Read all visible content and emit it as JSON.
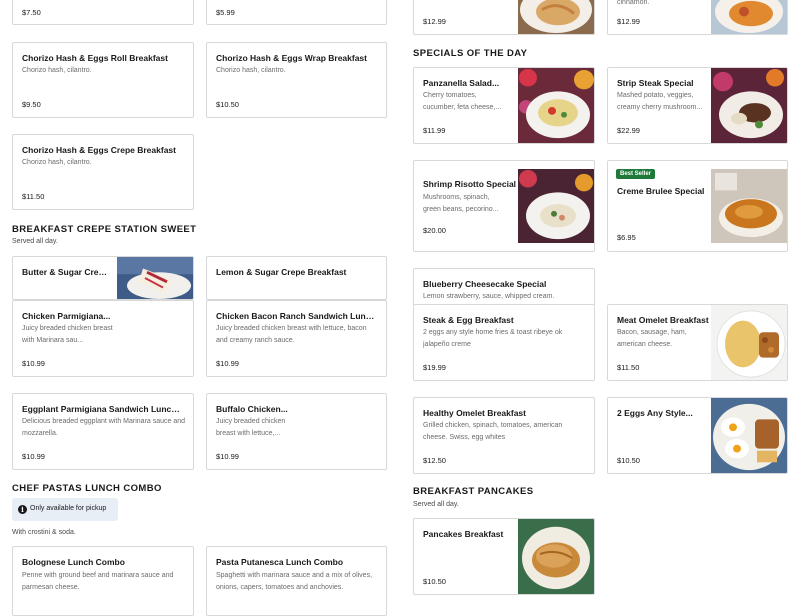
{
  "left": {
    "top_cards": [
      {
        "price": "$7.50"
      },
      {
        "price": "$5.99"
      }
    ],
    "chorizo_cards": [
      {
        "name": "Chorizo Hash & Eggs Roll Breakfast",
        "desc": "Chorizo hash, cilantro.",
        "price": "$9.50"
      },
      {
        "name": "Chorizo Hash & Eggs Wrap Breakfast",
        "desc": "Chorizo hash, cilantro.",
        "price": "$10.50"
      },
      {
        "name": "Chorizo Hash & Eggs Crepe Breakfast",
        "desc": "Chorizo hash, cilantro.",
        "price": "$11.50"
      }
    ],
    "crepe_section": {
      "title": "BREAKFAST CREPE STATION SWEET",
      "subtitle": "Served all day."
    },
    "crepe_cards": [
      {
        "name": "Butter & Sugar Crepe...",
        "image": "crepe-photo"
      },
      {
        "name": "Lemon & Sugar Crepe Breakfast"
      },
      {
        "name": "Chicken Parmigiana...",
        "desc": "Juicy breaded chicken breast with Marinara sau...",
        "price": "$10.99"
      },
      {
        "name": "Chicken Bacon Ranch Sandwich Lunch...",
        "desc": "Juicy breaded chicken breast with lettuce, bacon and creamy ranch sauce.",
        "price": "$10.99"
      },
      {
        "name": "Eggplant Parmigiana Sandwich Lunch...",
        "desc": "Delicious breaded eggplant with Marinara sauce and mozzarella.",
        "price": "$10.99"
      },
      {
        "name": "Buffalo Chicken...",
        "desc": "Juicy breaded chicken breast with lettuce,...",
        "price": "$10.99"
      }
    ],
    "pastas_section": {
      "title": "CHEF PASTAS LUNCH COMBO",
      "notice": "Only available for pickup",
      "info_icon": "info-icon",
      "note": "With crostini & soda."
    },
    "pasta_cards": [
      {
        "name": "Bolognese Lunch Combo",
        "desc": "Penne with ground beef and marinara sauce and parmesan cheese."
      },
      {
        "name": "Pasta Putanesca Lunch Combo",
        "desc": "Spaghetti with marinara sauce and a mix of olives, onions, capers, tomatoes and anchovies."
      }
    ]
  },
  "right": {
    "top_cards": [
      {
        "price": "$12.99",
        "image": "pasta-photo"
      },
      {
        "price": "$12.99",
        "desc": "cinnamon.",
        "image": "dish-photo"
      }
    ],
    "specials_section": {
      "title": "SPECIALS OF THE DAY"
    },
    "special_cards": [
      {
        "name": "Panzanella Salad...",
        "desc": "Cherry tomatoes, cucumber, feta cheese,...",
        "price": "$11.99",
        "image": "salad-photo"
      },
      {
        "name": "Strip Steak Special",
        "desc": "Mashed potato, veggies, creamy cherry mushroom...",
        "price": "$22.99",
        "image": "steak-photo"
      },
      {
        "name": "Shrimp Risotto Special",
        "desc": "Mushrooms, spinach, green beans, pecorino...",
        "price": "$20.00",
        "image": "risotto-photo"
      },
      {
        "name": "Creme Brulee Special",
        "badge": "Best Seller",
        "price": "$6.95",
        "image": "creme-brulee-photo"
      },
      {
        "name": "Blueberry Cheesecake Special",
        "desc": "Lemon strawberry, sauce, whipped cream."
      },
      {
        "name": "Steak & Egg Breakfast",
        "desc": "2 eggs any style home fries & toast ribeye ok jalapeño creme",
        "price": "$19.99"
      },
      {
        "name": "Meat Omelet Breakfast",
        "desc": "Bacon, sausage, ham, american cheese.",
        "price": "$11.50",
        "image": "omelet-photo"
      },
      {
        "name": "Healthy Omelet Breakfast",
        "desc": "Grilled chicken, spinach, tomatoes, american cheese. Swiss, egg whites",
        "price": "$12.50"
      },
      {
        "name": "2 Eggs Any Style...",
        "price": "$10.50",
        "image": "eggs-photo"
      }
    ],
    "pancakes_section": {
      "title": "BREAKFAST PANCAKES",
      "subtitle": "Served all day."
    },
    "pancake_cards": [
      {
        "name": "Pancakes Breakfast",
        "price": "$10.50",
        "image": "pancakes-photo"
      }
    ]
  }
}
